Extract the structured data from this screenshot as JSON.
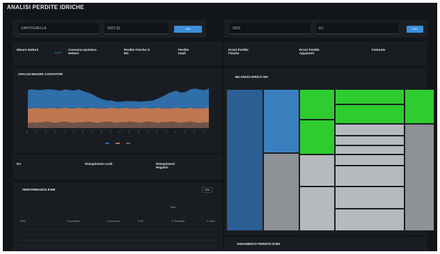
{
  "page_title": "ANALISI PERDITE IDRICHE",
  "filters_left": {
    "field_a": {
      "caption": "",
      "value": "CAPOTERELLA"
    },
    "field_b": {
      "caption": "",
      "value": "2023 Q1"
    },
    "button_label": "Filtri"
  },
  "filters_right": {
    "field_a": {
      "caption": "",
      "value": "2020"
    },
    "field_b": {
      "caption": "",
      "value": "RJ"
    },
    "button_label": "Filtri"
  },
  "kpis_left": [
    {
      "label": "Misure Settore",
      "value": "48.22"
    },
    {
      "label": "Consumo Ipotetico Settore",
      "value": ""
    },
    {
      "label": "Perdite Fisiche in MC",
      "value": ""
    },
    {
      "label": "Perdite totali",
      "value": ""
    }
  ],
  "kpis_right": [
    {
      "label": "Errori Perdite Fisiche",
      "value": ""
    },
    {
      "label": "Errori Perdite Apparenti",
      "value": ""
    },
    {
      "label": "Fatturato",
      "value": ""
    }
  ],
  "chart_panel": {
    "title": "ANALISI MISURE CONTATORI",
    "legend": [
      "",
      "",
      ""
    ]
  },
  "kpis_mid": [
    {
      "label": "RJ",
      "value": ""
    },
    {
      "label": "Riempimenti Lordi",
      "value": ""
    },
    {
      "label": "Riempimenti Negativi",
      "value": ""
    }
  ],
  "perf_panel": {
    "title": "PERFORMANCE RJMI",
    "button_label": "Filtri",
    "group_label": "Totali",
    "columns": [
      "Rete",
      "% Accettate",
      "% Anomale",
      "% RJ",
      "% Sostituite",
      "% Varie"
    ],
    "rows": [
      [
        "",
        "",
        "",
        "",
        "",
        ""
      ],
      [
        "",
        "",
        "",
        "",
        "",
        ""
      ],
      [
        "",
        "",
        "",
        "",
        "",
        ""
      ],
      [
        "",
        "",
        "",
        "",
        "",
        ""
      ]
    ]
  },
  "treemap_panel": {
    "title": "BILANCIO IDRICO WA",
    "subtitle": "",
    "cells": [
      {
        "label": "",
        "value": ""
      },
      {
        "label": "",
        "value": ""
      },
      {
        "label": "",
        "value": ""
      },
      {
        "label": "",
        "value": ""
      },
      {
        "label": "",
        "value": ""
      },
      {
        "label": "",
        "value": ""
      },
      {
        "label": "",
        "value": ""
      },
      {
        "label": "",
        "value": ""
      },
      {
        "label": "",
        "value": ""
      },
      {
        "label": "",
        "value": ""
      },
      {
        "label": "",
        "value": ""
      },
      {
        "label": "",
        "value": ""
      },
      {
        "label": "",
        "value": ""
      },
      {
        "label": "",
        "value": ""
      },
      {
        "label": "",
        "value": ""
      },
      {
        "label": "",
        "value": ""
      },
      {
        "label": "",
        "value": ""
      },
      {
        "label": "",
        "value": ""
      }
    ]
  },
  "bottom_panel": {
    "title": "ANDAMENTO PERDITE RJMI",
    "subtitle": ""
  },
  "colors": {
    "blue": "#2f6ea8",
    "orange": "#c07650",
    "green": "#2ecc2e",
    "grey": "#8e9196",
    "accent": "#3b8fd9"
  },
  "chart_data": {
    "type": "area",
    "title": "ANALISI MISURE CONTATORI",
    "series": [
      {
        "values": [
          30,
          30,
          31,
          30,
          30,
          31,
          30,
          30,
          31,
          30,
          30,
          31,
          30,
          30,
          31,
          30,
          30,
          30,
          31,
          30,
          30,
          31,
          30,
          30,
          30,
          31,
          30,
          30,
          31,
          30,
          30,
          30,
          31,
          30,
          30,
          31,
          30,
          30,
          30,
          31
        ]
      },
      {
        "values": [
          28,
          29,
          27,
          28,
          29,
          28,
          28,
          27,
          28,
          28,
          27,
          28,
          26,
          24,
          20,
          17,
          14,
          12,
          11,
          10,
          10,
          10,
          11,
          11,
          10,
          10,
          11,
          12,
          14,
          18,
          22,
          25,
          26,
          24,
          25,
          28,
          30,
          29,
          28,
          29
        ]
      },
      {
        "values": [
          8,
          9,
          8,
          9,
          10,
          9,
          8,
          9,
          10,
          9,
          8,
          9,
          9,
          10,
          9,
          8,
          9,
          10,
          9,
          8,
          9,
          9,
          10,
          9,
          8,
          9,
          10,
          9,
          8,
          9,
          9,
          10,
          9,
          8,
          9,
          10,
          9,
          8,
          9,
          9
        ]
      }
    ]
  }
}
